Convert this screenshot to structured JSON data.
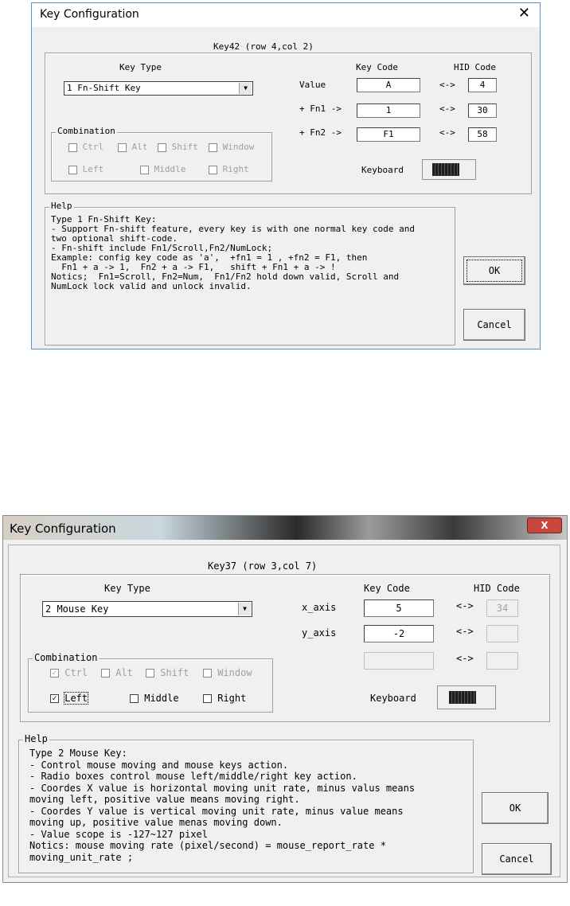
{
  "dialog1": {
    "title": "Key Configuration",
    "close_glyph": "✕",
    "key_id": "Key42 (row 4,col 2)",
    "key_type_label": "Key Type",
    "key_type_value": "1 Fn-Shift Key",
    "key_code_label": "Key Code",
    "hid_code_label": "HID Code",
    "rows": [
      {
        "label": "Value",
        "key_code": "A",
        "arrow": "<->",
        "hid": "4"
      },
      {
        "label": "+ Fn1 ->",
        "key_code": "1",
        "arrow": "<->",
        "hid": "30"
      },
      {
        "label": "+ Fn2 ->",
        "key_code": "F1",
        "arrow": "<->",
        "hid": "58"
      }
    ],
    "combination_label": "Combination",
    "combination": {
      "ctrl": "Ctrl",
      "alt": "Alt",
      "shift": "Shift",
      "window": "Window",
      "left": "Left",
      "middle": "Middle",
      "right": "Right"
    },
    "keyboard_label": "Keyboard",
    "help_label": "Help",
    "help_text": "Type 1 Fn-Shift Key:\n- Support Fn-shift feature, every key is with one normal key code and\ntwo optional shift-code.\n- Fn-shift include Fn1/Scroll,Fn2/NumLock;\nExample: config key code as 'a',  +fn1 = 1 , +fn2 = F1, then\n  Fn1 + a -> 1,  Fn2 + a -> F1,   shift + Fn1 + a -> !\nNotics;  Fn1=Scroll, Fn2=Num,  Fn1/Fn2 hold down valid, Scroll and\nNumLock lock valid and unlock invalid.",
    "ok_label": "OK",
    "cancel_label": "Cancel"
  },
  "dialog2": {
    "title": "Key Configuration",
    "close_glyph": "X",
    "key_id": "Key37 (row 3,col 7)",
    "key_type_label": "Key Type",
    "key_type_value": "2 Mouse Key",
    "key_code_label": "Key Code",
    "hid_code_label": "HID Code",
    "rows": [
      {
        "label": "x_axis",
        "key_code": "5",
        "arrow": "<->",
        "hid": "34"
      },
      {
        "label": "y_axis",
        "key_code": "-2",
        "arrow": "<->",
        "hid": ""
      },
      {
        "label": "",
        "key_code": "",
        "arrow": "<->",
        "hid": ""
      }
    ],
    "combination_label": "Combination",
    "combination": {
      "ctrl": "Ctrl",
      "alt": "Alt",
      "shift": "Shift",
      "window": "Window",
      "left": "Left",
      "middle": "Middle",
      "right": "Right"
    },
    "left_checked": true,
    "ctrl_checked": true,
    "keyboard_label": "Keyboard",
    "help_label": "Help",
    "help_text": "Type 2 Mouse Key:\n- Control mouse moving and mouse keys action.\n- Radio boxes control mouse left/middle/right key action.\n- Coordes X value is horizontal moving unit rate, minus valus means\nmoving left, positive value means moving right.\n- Coordes Y value is vertical moving unit rate, minus value means\nmoving up, positive value menas moving down.\n- Value scope is -127~127 pixel\nNotics: mouse moving rate (pixel/second) = mouse_report_rate *\nmoving_unit_rate ;",
    "ok_label": "OK",
    "cancel_label": "Cancel"
  }
}
